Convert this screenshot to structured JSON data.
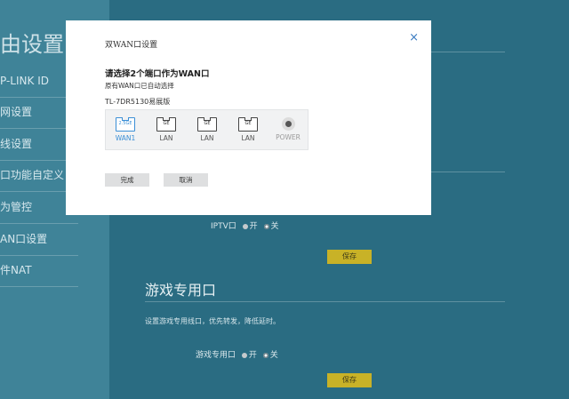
{
  "sidebar": {
    "title": "由设置",
    "items": [
      {
        "label": "P-LINK ID"
      },
      {
        "label": "网设置"
      },
      {
        "label": "线设置"
      },
      {
        "label": "口功能自定义"
      },
      {
        "label": "为管控"
      },
      {
        "label": "AN口设置"
      },
      {
        "label": "件NAT"
      }
    ]
  },
  "iptv": {
    "label": "IPTV口",
    "on_label": "开",
    "off_label": "关",
    "selected": "关",
    "save_label": "保存"
  },
  "game_port": {
    "section_title": "游戏专用口",
    "description": "设置游戏专用线口，优先转发，降低延时。",
    "label": "游戏专用口",
    "on_label": "开",
    "off_label": "关",
    "selected": "关",
    "save_label": "保存"
  },
  "dialog": {
    "title": "双WAN口设置",
    "close_glyph": "×",
    "heading": "请选择2个端口作为WAN口",
    "subtext": "原有WAN口已自动选择",
    "model": "TL-7DR5130易展版",
    "ports": [
      {
        "chip": "2.5GE",
        "label": "WAN1",
        "type": "wan"
      },
      {
        "chip": "GE",
        "label": "LAN",
        "type": "lan"
      },
      {
        "chip": "GE",
        "label": "LAN",
        "type": "lan"
      },
      {
        "chip": "GE",
        "label": "LAN",
        "type": "lan"
      },
      {
        "chip": "",
        "label": "POWER",
        "type": "power"
      }
    ],
    "confirm_label": "完成",
    "cancel_label": "取消"
  },
  "colors": {
    "background": "#2a6c82",
    "sidebar": "#3f8398",
    "save_button": "#c8b227",
    "wan_accent": "#3b8fd6",
    "close_icon": "#3a7bc0"
  }
}
